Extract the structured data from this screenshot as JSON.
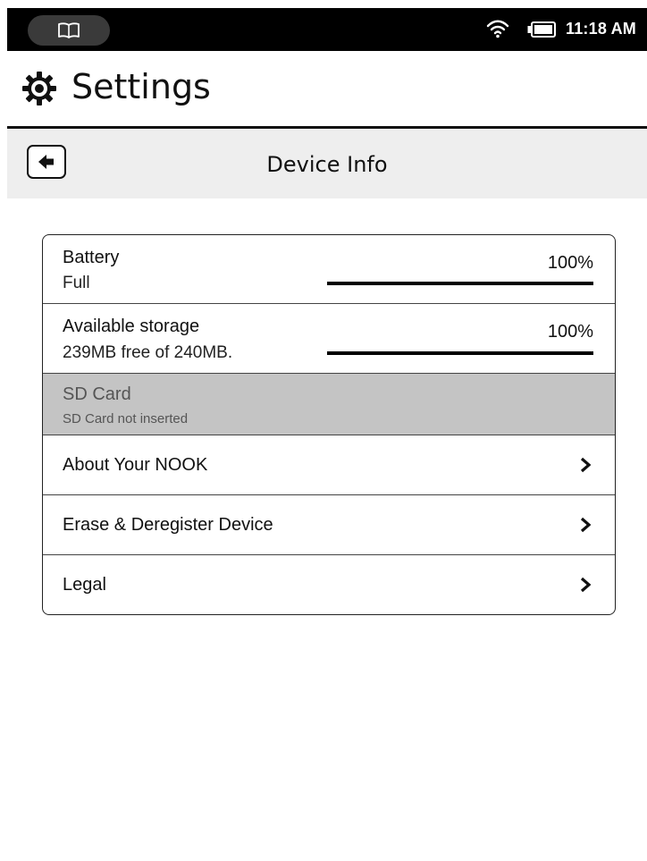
{
  "status_bar": {
    "library_icon": "open-book-icon",
    "wifi_icon": "wifi-icon",
    "battery_icon": "battery-icon",
    "time": "11:18 AM"
  },
  "header": {
    "icon": "gear-icon",
    "title": "Settings"
  },
  "sub_header": {
    "back_icon": "back-arrow-icon",
    "title": "Device Info"
  },
  "items": [
    {
      "label": "Battery",
      "sub": "Full",
      "value": "100%",
      "level": 1.0
    },
    {
      "label": "Available storage",
      "sub": "239MB free of 240MB.",
      "value": "100%",
      "level": 1.0
    },
    {
      "label": "SD Card",
      "sub": "SD Card not inserted",
      "disabled": true
    },
    {
      "label": "About Your NOOK",
      "icon": "chevron-right-icon"
    },
    {
      "label": "Erase & Deregister Device",
      "icon": "chevron-right-icon"
    },
    {
      "label": "Legal",
      "icon": "chevron-right-icon"
    }
  ],
  "colors": {
    "status_bar": "#000000",
    "sub_header": "#eeeeee",
    "disabled_row": "#c4c4c4"
  }
}
